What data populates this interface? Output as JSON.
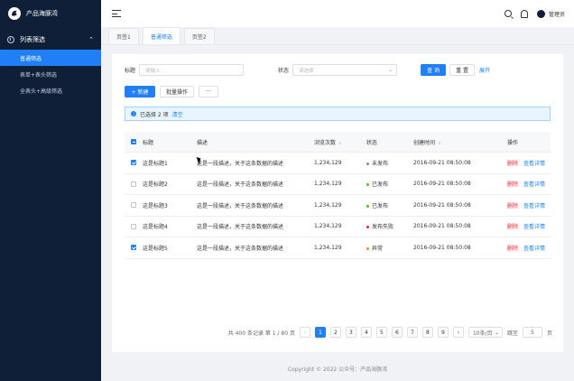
{
  "app": {
    "title": "产品海豚湾"
  },
  "sidebar": {
    "group_label": "列表筛选",
    "items": [
      {
        "label": "普通筛选",
        "active": true
      },
      {
        "label": "表单+表头筛选",
        "active": false
      },
      {
        "label": "全表头+高级筛选",
        "active": false
      }
    ]
  },
  "header": {
    "user": "管理员"
  },
  "tabs": [
    {
      "label": "页签1",
      "active": false
    },
    {
      "label": "普通筛选",
      "active": true
    },
    {
      "label": "页签2",
      "active": false
    }
  ],
  "filters": {
    "title_label": "标题",
    "title_placeholder": "请输入",
    "status_label": "状态",
    "status_placeholder": "请选择",
    "query_label": "查 询",
    "reset_label": "重 置",
    "expand_label": "展开"
  },
  "toolbar": {
    "new_label": "+ 新建",
    "batch_label": "批量操作",
    "more_label": "···"
  },
  "alert": {
    "text": "已选择 2 项",
    "clear_label": "清空"
  },
  "table": {
    "headers": {
      "title": "标题",
      "desc": "描述",
      "views": "浏览次数",
      "status": "状态",
      "time": "创建时间",
      "ops": "操作"
    },
    "rows": [
      {
        "checked": true,
        "title": "这是标题1",
        "desc": "这是一段描述，关于这条数据的描述",
        "views": "1,234,129",
        "status": "未发布",
        "status_color": "#8c8c8c",
        "time": "2016-09-21  08:50:08"
      },
      {
        "checked": false,
        "title": "这是标题2",
        "desc": "这是一段描述，关于这条数据的描述",
        "views": "1,234,129",
        "status": "已发布",
        "status_color": "#52c41a",
        "time": "2016-09-21  08:50:08"
      },
      {
        "checked": false,
        "title": "这是标题3",
        "desc": "这是一段描述，关于这条数据的描述",
        "views": "1,234,129",
        "status": "已发布",
        "status_color": "#52c41a",
        "time": "2016-09-21  08:50:08"
      },
      {
        "checked": false,
        "title": "这是标题4",
        "desc": "这是一段描述，关于这条数据的描述",
        "views": "1,234,129",
        "status": "发布失败",
        "status_color": "#f5222d",
        "time": "2016-09-21  08:50:08"
      },
      {
        "checked": true,
        "title": "这是标题5",
        "desc": "这是一段描述，关于这条数据的描述",
        "views": "1,234,129",
        "status": "异常",
        "status_color": "#fa8c16",
        "time": "2016-09-21  08:50:08"
      }
    ],
    "op_delete": "删除",
    "op_view": "查看详情"
  },
  "pagination": {
    "summary": "共 400 条记录  第 1 / 80 页",
    "pages": [
      "1",
      "2",
      "3",
      "4",
      "5",
      "6",
      "7",
      "8",
      "9"
    ],
    "current": "1",
    "page_size": "10条/页",
    "jump_label": "跳至",
    "jump_value": "5",
    "page_suffix": "页"
  },
  "footer": {
    "text": "Copyright © 2022 公众号：产品海豚湾"
  },
  "colors": {
    "primary": "#1f7ff7",
    "sidebar": "#0f1f38"
  }
}
